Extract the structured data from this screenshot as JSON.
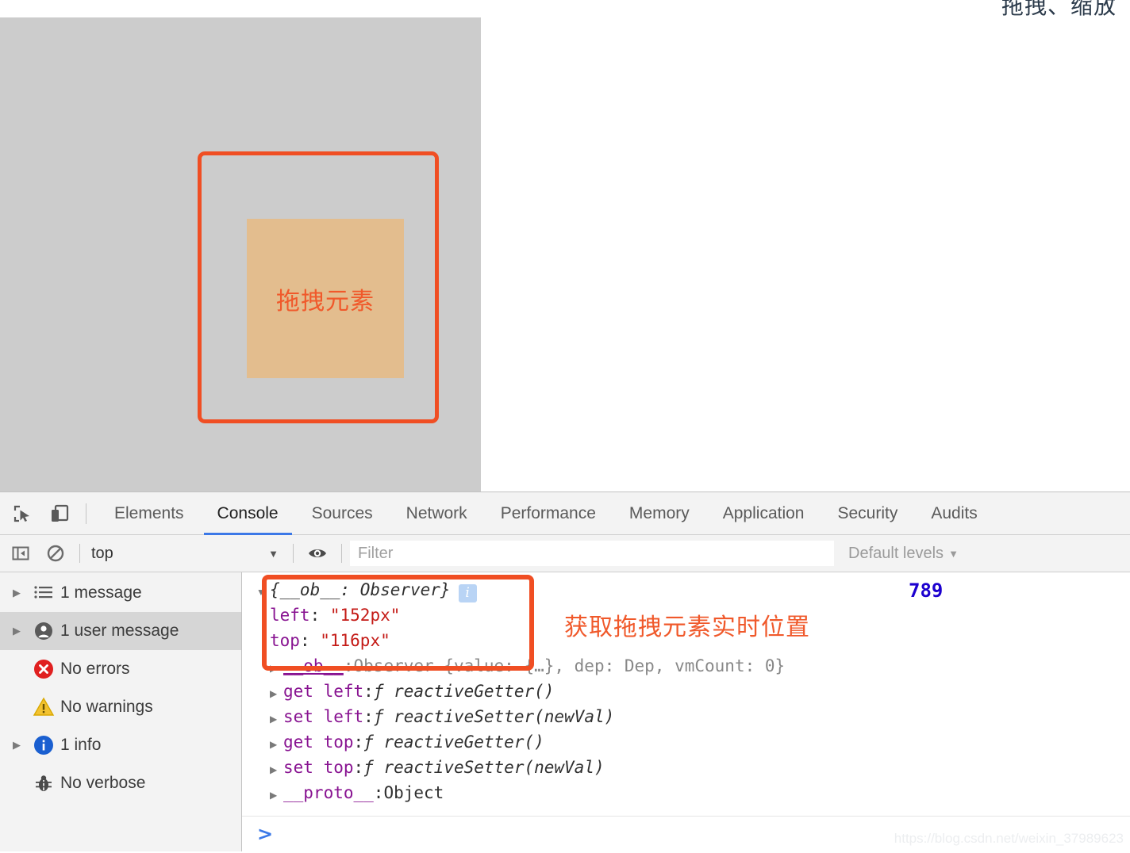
{
  "page": {
    "heading_clipped": "拖拽、缩放",
    "drop_zone_name": "drop-zone",
    "drag_element_label": "拖拽元素"
  },
  "devtools": {
    "toolbar_icons": [
      {
        "name": "inspect-element-icon",
        "label": "Inspect element"
      },
      {
        "name": "device-toolbar-icon",
        "label": "Toggle device toolbar"
      }
    ],
    "tabs": [
      {
        "label": "Elements",
        "active": false
      },
      {
        "label": "Console",
        "active": true
      },
      {
        "label": "Sources",
        "active": false
      },
      {
        "label": "Network",
        "active": false
      },
      {
        "label": "Performance",
        "active": false
      },
      {
        "label": "Memory",
        "active": false
      },
      {
        "label": "Application",
        "active": false
      },
      {
        "label": "Security",
        "active": false
      },
      {
        "label": "Audits",
        "active": false
      }
    ],
    "active_tab": "Console",
    "accent_color": "#3b78e7"
  },
  "filterbar": {
    "sidebar_toggle_icon": "console-sidebar-toggle-icon",
    "clear_icon": "clear-console-icon",
    "context": "top",
    "context_caret": "▼",
    "eye_icon": "live-expression-eye-icon",
    "filter_placeholder": "Filter",
    "filter_value": "",
    "levels_label": "Default levels",
    "levels_caret": "▼"
  },
  "sidebar": {
    "items": [
      {
        "label": "1 message",
        "icon": "list-icon",
        "expandable": true,
        "selected": false
      },
      {
        "label": "1 user message",
        "icon": "user-icon",
        "expandable": true,
        "selected": true
      },
      {
        "label": "No errors",
        "icon": "error-icon",
        "expandable": false,
        "selected": false
      },
      {
        "label": "No warnings",
        "icon": "warning-icon",
        "expandable": false,
        "selected": false
      },
      {
        "label": "1 info",
        "icon": "info-icon",
        "expandable": true,
        "selected": false
      },
      {
        "label": "No verbose",
        "icon": "bug-icon",
        "expandable": false,
        "selected": false
      }
    ]
  },
  "console": {
    "object_header": "{__ob__: Observer}",
    "header_triangle": "▼",
    "info_badge": "i",
    "props": [
      {
        "key": "left",
        "value": "\"152px\""
      },
      {
        "key": "top",
        "value": "\"116px\""
      }
    ],
    "rows": [
      {
        "triangle": "▶",
        "key": "__ob__",
        "sep": ": ",
        "value": "Observer {value: {…}, dep: Dep, vmCount: 0}"
      },
      {
        "triangle": "▶",
        "key": "get left",
        "sep": ": ",
        "value": "ƒ reactiveGetter()"
      },
      {
        "triangle": "▶",
        "key": "set left",
        "sep": ": ",
        "value": "ƒ reactiveSetter(newVal)"
      },
      {
        "triangle": "▶",
        "key": "get top",
        "sep": ": ",
        "value": "ƒ reactiveGetter()"
      },
      {
        "triangle": "▶",
        "key": "set top",
        "sep": ": ",
        "value": "ƒ reactiveSetter(newVal)"
      },
      {
        "triangle": "▶",
        "key": "__proto__",
        "sep": ": ",
        "value": "Object"
      }
    ],
    "repeat_count": "789",
    "annotation": "获取拖拽元素实时位置",
    "annotation_color": "#f0592b",
    "prompt_caret": ">"
  },
  "watermark": "https://blog.csdn.net/weixin_37989623"
}
